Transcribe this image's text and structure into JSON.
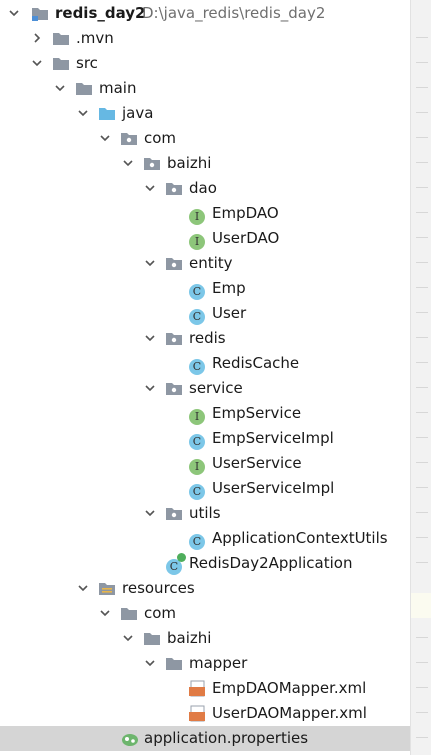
{
  "tree": {
    "root": {
      "label": "redis_day2",
      "path": "D:\\java_redis\\redis_day2"
    },
    "items": [
      {
        "label": ".mvn"
      },
      {
        "label": "src"
      },
      {
        "label": "main"
      },
      {
        "label": "java"
      },
      {
        "label": "com"
      },
      {
        "label": "baizhi"
      },
      {
        "label": "dao"
      },
      {
        "label": "EmpDAO",
        "badge": "I"
      },
      {
        "label": "UserDAO",
        "badge": "I"
      },
      {
        "label": "entity"
      },
      {
        "label": "Emp",
        "badge": "C"
      },
      {
        "label": "User",
        "badge": "C"
      },
      {
        "label": "redis"
      },
      {
        "label": "RedisCache",
        "badge": "C"
      },
      {
        "label": "service"
      },
      {
        "label": "EmpService",
        "badge": "I"
      },
      {
        "label": "EmpServiceImpl",
        "badge": "C"
      },
      {
        "label": "UserService",
        "badge": "I"
      },
      {
        "label": "UserServiceImpl",
        "badge": "C"
      },
      {
        "label": "utils"
      },
      {
        "label": "ApplicationContextUtils",
        "badge": "C"
      },
      {
        "label": "RedisDay2Application",
        "badge": "C"
      },
      {
        "label": "resources"
      },
      {
        "label": "com"
      },
      {
        "label": "baizhi"
      },
      {
        "label": "mapper"
      },
      {
        "label": "EmpDAOMapper.xml",
        "badge": "<>"
      },
      {
        "label": "UserDAOMapper.xml",
        "badge": "<>"
      },
      {
        "label": "application.properties"
      }
    ]
  },
  "colors": {
    "folder": "#8e97a3",
    "source_folder": "#66b8e3",
    "class_badge": "#7cc7e8",
    "interface_badge": "#8dc67a",
    "xml_icon": "#e07b45",
    "selection": "#d5d5d5"
  }
}
